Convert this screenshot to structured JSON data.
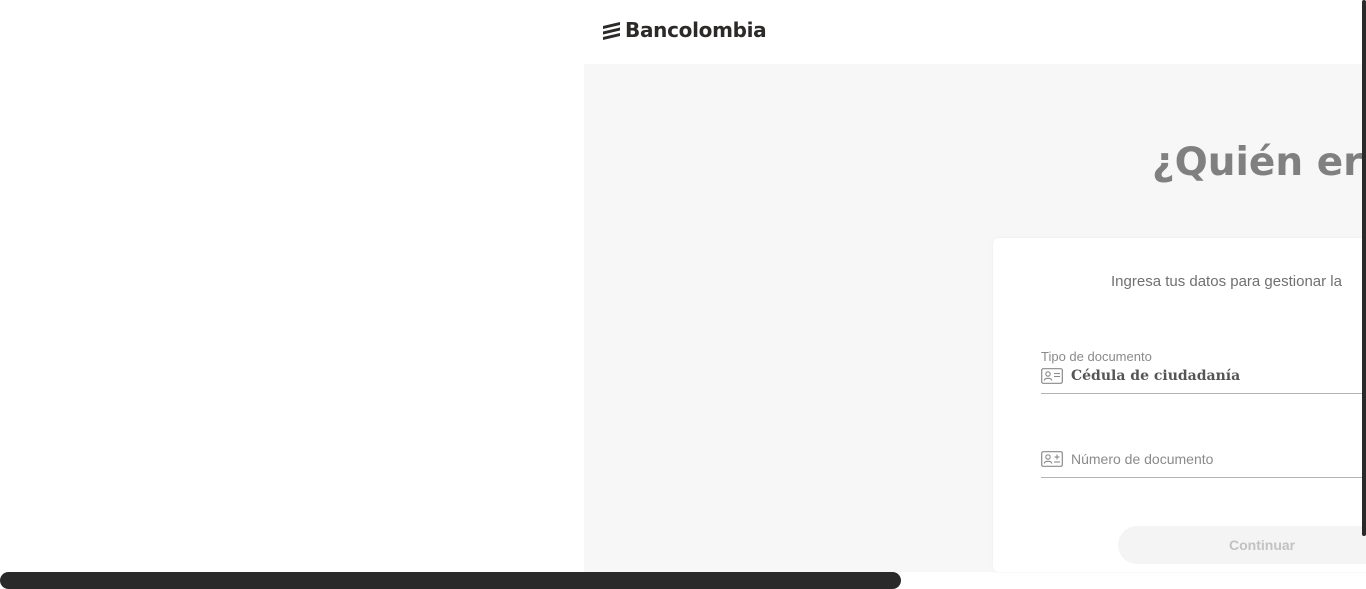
{
  "brand": {
    "name": "Bancolombia",
    "text_color": "#2c2a29"
  },
  "main": {
    "heading": "¿Quién eres"
  },
  "card": {
    "intro": "Ingresa tus datos para gestionar la",
    "document_type": {
      "label": "Tipo de documento",
      "value": "Cédula de ciudadanía",
      "icon": "id-card-icon"
    },
    "document_number": {
      "placeholder": "Número de documento",
      "value": "",
      "icon": "id-card-icon"
    },
    "continue_label": "Continuar"
  },
  "colors": {
    "panel_background": "#f7f7f7",
    "heading": "#808080",
    "disabled_button_bg": "#f4f4f4",
    "disabled_button_text": "#c2c2c2"
  }
}
